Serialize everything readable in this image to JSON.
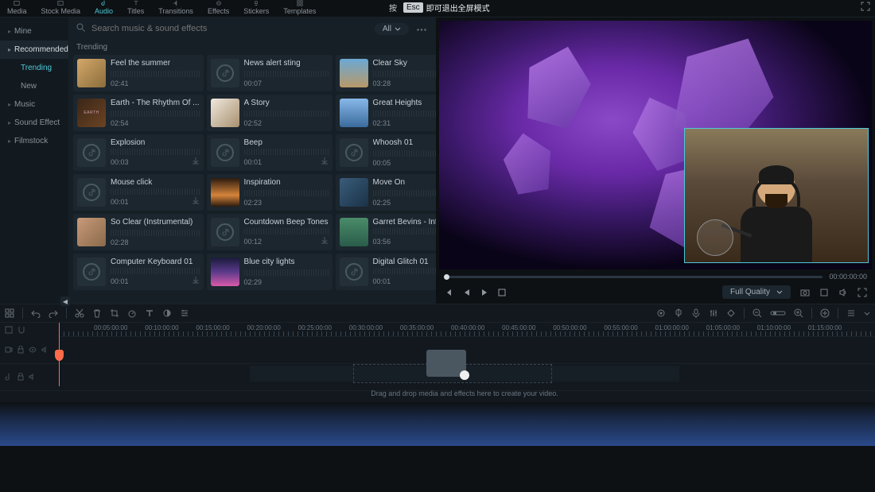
{
  "topTabs": [
    {
      "label": "Media"
    },
    {
      "label": "Stock Media"
    },
    {
      "label": "Audio",
      "active": true
    },
    {
      "label": "Titles"
    },
    {
      "label": "Transitions"
    },
    {
      "label": "Effects"
    },
    {
      "label": "Stickers"
    },
    {
      "label": "Templates"
    }
  ],
  "fullscreen": {
    "press": "按",
    "esc": "Esc",
    "txt": "即可退出全屏模式"
  },
  "sidebar": {
    "items": [
      {
        "label": "Mine"
      },
      {
        "label": "Recommended",
        "sel": true,
        "subs": [
          {
            "label": "Trending",
            "active": true
          },
          {
            "label": "New"
          }
        ]
      },
      {
        "label": "Music"
      },
      {
        "label": "Sound Effect"
      },
      {
        "label": "Filmstock"
      }
    ]
  },
  "search": {
    "placeholder": "Search music & sound effects",
    "filter": "All"
  },
  "sectionHeader": "Trending",
  "cards": [
    {
      "title": "Feel the summer",
      "dur": "02:41",
      "thumb": "img1"
    },
    {
      "title": "News alert sting",
      "dur": "00:07",
      "thumb": "note",
      "heart": true
    },
    {
      "title": "Clear Sky",
      "dur": "03:28",
      "thumb": "img3"
    },
    {
      "title": "Earth - The Rhythm Of ...",
      "dur": "02:54",
      "thumb": "img4"
    },
    {
      "title": "A Story",
      "dur": "02:52",
      "thumb": "img5"
    },
    {
      "title": "Great Heights",
      "dur": "02:31",
      "thumb": "img6"
    },
    {
      "title": "Explosion",
      "dur": "00:03",
      "thumb": "note",
      "dl": true
    },
    {
      "title": "Beep",
      "dur": "00:01",
      "thumb": "note",
      "dl": true
    },
    {
      "title": "Whoosh 01",
      "dur": "00:05",
      "thumb": "note"
    },
    {
      "title": "Mouse click",
      "dur": "00:01",
      "thumb": "note",
      "dl": true
    },
    {
      "title": "Inspiration",
      "dur": "02:23",
      "thumb": "img7"
    },
    {
      "title": "Move On",
      "dur": "02:25",
      "thumb": "img8"
    },
    {
      "title": "So Clear (Instrumental)",
      "dur": "02:28",
      "thumb": "img9"
    },
    {
      "title": "Countdown Beep Tones",
      "dur": "00:12",
      "thumb": "note",
      "dl": true
    },
    {
      "title": "Garret Bevins - Infinite ...",
      "dur": "03:56",
      "thumb": "img10",
      "dl": true
    },
    {
      "title": "Computer Keyboard 01",
      "dur": "00:01",
      "thumb": "note",
      "dl": true
    },
    {
      "title": "Blue city lights",
      "dur": "02:29",
      "thumb": "img11"
    },
    {
      "title": "Digital Glitch 01",
      "dur": "00:01",
      "thumb": "note",
      "dl": true
    }
  ],
  "preview": {
    "timecode": "00:00:00:00",
    "quality": "Full Quality"
  },
  "ruler": [
    "00:05:00:00",
    "00:10:00:00",
    "00:15:00:00",
    "00:20:00:00",
    "00:25:00:00",
    "00:30:00:00",
    "00:35:00:00",
    "00:40:00:00",
    "00:45:00:00",
    "00:50:00:00",
    "00:55:00:00",
    "01:00:00:00",
    "01:05:00:00",
    "01:10:00:00",
    "01:15:00:00"
  ],
  "dropText": "Drag and drop media and effects here to create your video."
}
